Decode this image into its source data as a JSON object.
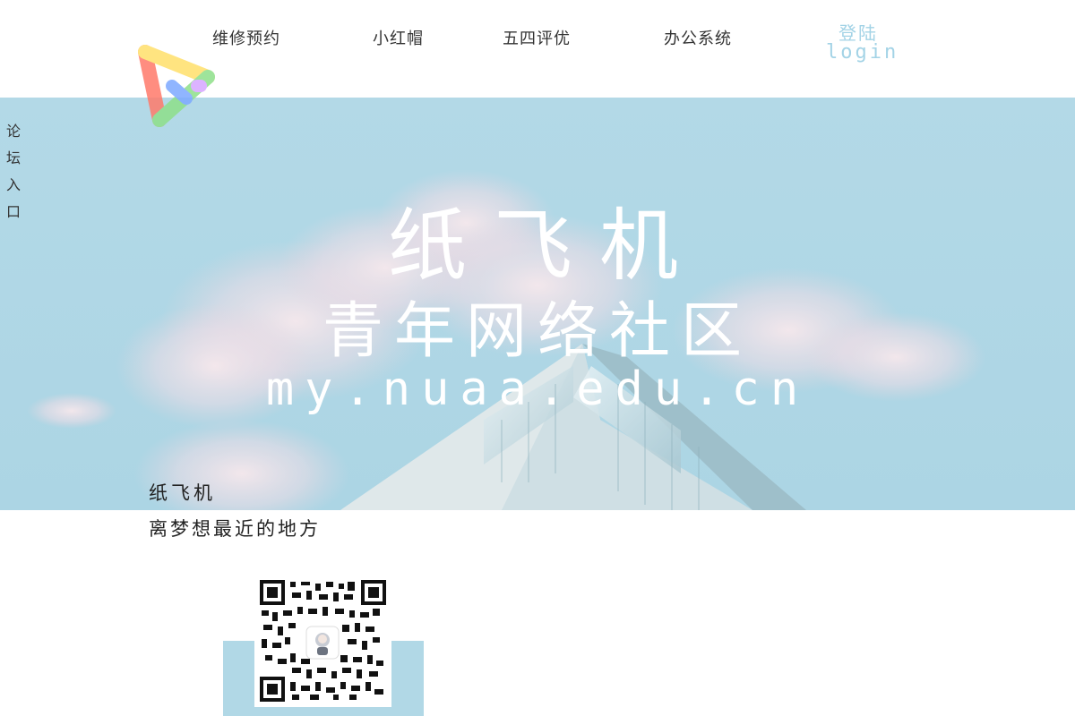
{
  "header": {
    "nav": [
      {
        "label": "维修预约"
      },
      {
        "label": "小红帽"
      },
      {
        "label": "五四评优"
      },
      {
        "label": "办公系统"
      }
    ],
    "login": {
      "label_zh": "登陆",
      "label_en": "login"
    }
  },
  "side_entry": {
    "chars": [
      "论",
      "坛",
      "入",
      "口"
    ]
  },
  "hero": {
    "title": "纸飞机",
    "subtitle": "青年网络社区",
    "url": "my.nuaa.edu.cn",
    "caption": "纸飞机"
  },
  "slogan": "离梦想最近的地方",
  "colors": {
    "accent": "#b1d8e6",
    "login": "#a3d3e6",
    "text": "#333333"
  }
}
